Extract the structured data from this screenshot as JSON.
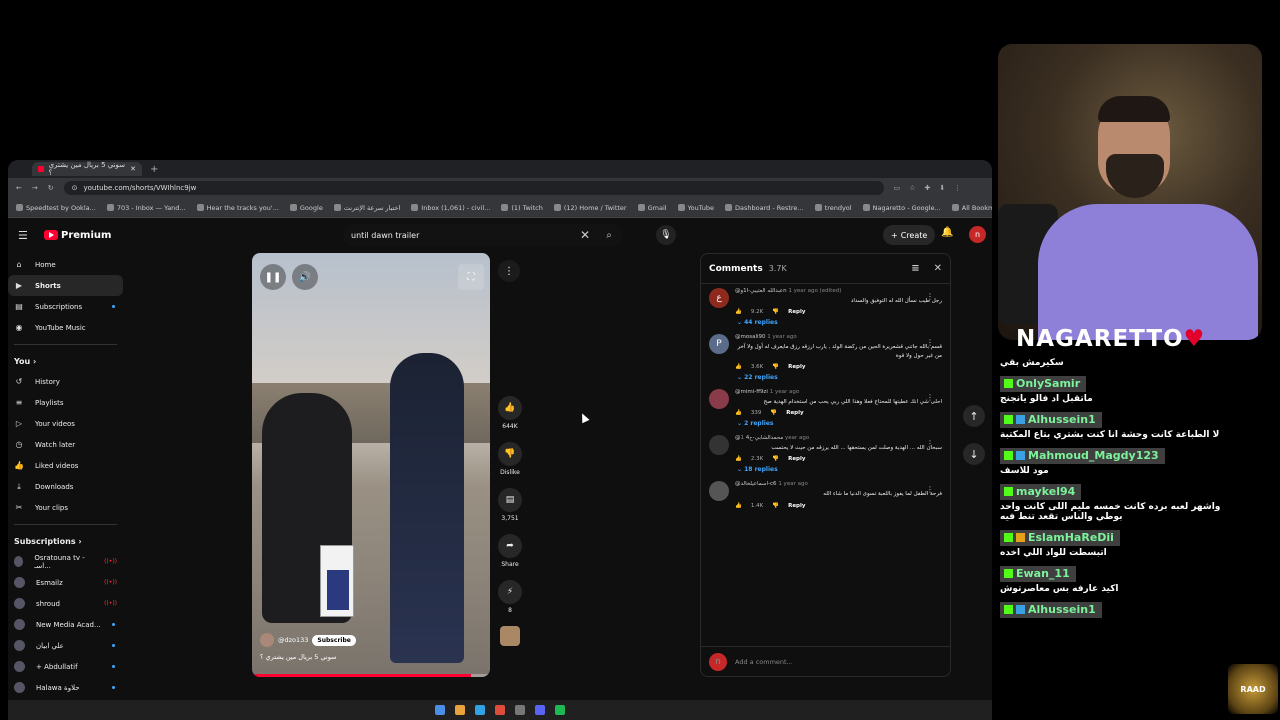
{
  "browser": {
    "tab_title": "سوني 5 بريال مين يشتري ؟",
    "url": "youtube.com/shorts/VWIhlnc9jw",
    "bookmarks": [
      "Speedtest by Ookla...",
      "703 - Inbox — Yand...",
      "Hear the tracks you'...",
      "Google",
      "اختبار سرعة الإنترنت",
      "Inbox (1,061) - civil...",
      "(1) Twitch",
      "(12) Home / Twitter",
      "Gmail",
      "YouTube",
      "Dashboard - Restre...",
      "trendyol",
      "Nagaretto - Google...",
      "All Bookmarks"
    ]
  },
  "youtube": {
    "logo_label": "Premium",
    "search_value": "until dawn trailer",
    "create_label": "Create",
    "sidebar": {
      "main": [
        {
          "label": "Home",
          "icon": "home-icon"
        },
        {
          "label": "Shorts",
          "icon": "shorts-icon"
        },
        {
          "label": "Subscriptions",
          "icon": "subscriptions-icon"
        },
        {
          "label": "YouTube Music",
          "icon": "music-icon"
        }
      ],
      "you_label": "You",
      "you": [
        {
          "label": "History"
        },
        {
          "label": "Playlists"
        },
        {
          "label": "Your videos"
        },
        {
          "label": "Watch later"
        },
        {
          "label": "Liked videos"
        },
        {
          "label": "Downloads"
        },
        {
          "label": "Your clips"
        }
      ],
      "subs_label": "Subscriptions",
      "subs": [
        {
          "label": "Osratouna tv - اسـ..."
        },
        {
          "label": "Esmailz"
        },
        {
          "label": "shroud"
        },
        {
          "label": "New Media Acad..."
        },
        {
          "label": "علي ابيان"
        },
        {
          "label": "+ Abdullatif"
        },
        {
          "label": "Halawa حلاوة"
        }
      ]
    },
    "short": {
      "channel": "@dzo133",
      "subscribe_label": "Subscribe",
      "caption": "سوني 5 بريال مين يشتري ؟",
      "progress": 0.92
    },
    "actions": {
      "likes": "644K",
      "dislike_label": "Dislike",
      "comments": "3,751",
      "share_label": "Share",
      "remix": "8"
    },
    "comments": {
      "title": "Comments",
      "count": "3.7K",
      "add_placeholder": "Add a comment...",
      "items": [
        {
          "avatar": "ع",
          "user": "@عبدالله العتيبي-ا1وn",
          "time": "1 year ago (edited)",
          "text": "رجل طيب نسأل الله له التوفيق والسداد",
          "likes": "9.2K",
          "reply_label": "Reply",
          "replies": "44 replies"
        },
        {
          "avatar": "P",
          "user": "@mosali90",
          "time": "1 year ago",
          "text": "قسم بالله جاتني قشعريرة الحين من ركضة الولد , يارب ارزقه رزق مايعرف له أول ولا آخر من غير حول ولا قوة",
          "likes": "3.6K",
          "reply_label": "Reply",
          "replies": "22 replies"
        },
        {
          "avatar": "",
          "user": "@mimi-ff9zi",
          "time": "1 year ago",
          "text": "احلى شي انك عطيتها للمحتاج فعلا وهذا اللي ربي يحب من استخدام الهدية صح",
          "likes": "339",
          "reply_label": "Reply",
          "replies": "2 replies"
        },
        {
          "avatar": "",
          "user": "@محمدالشابي-ح4",
          "time": "1 year ago",
          "text": "سبحان الله ... الهدية وصلت لمن يستحقها ... الله يرزقه من حيث لا يحتسب",
          "likes": "2.3K",
          "reply_label": "Reply",
          "replies": "18 replies"
        },
        {
          "avatar": "",
          "user": "@اسماعيلخالد-c6",
          "time": "1 year ago",
          "text": "فرحة الطفل لما يفوز باللعبة تسوى الدنيا ما شاء الله",
          "likes": "1.4K",
          "reply_label": "Reply",
          "replies": ""
        }
      ]
    }
  },
  "stream": {
    "streamer_name": "NAGARETTO",
    "chat": [
      {
        "user": "",
        "msg": "سكيرمش بقي",
        "color": "green"
      },
      {
        "user": "OnlySamir",
        "msg": "ماتقبل اد فالو يانجنج",
        "color": "green"
      },
      {
        "user": "Alhussein1",
        "msg": "لا الطباعة كانت وحشة انا كنت بشتري بتاع المكتبة",
        "color": "green"
      },
      {
        "user": "Mahmoud_Magdy123",
        "msg": "مود للاسف",
        "color": "green"
      },
      {
        "user": "maykel94",
        "msg": "واشهر لعبه برده كانت خمسه مليم اللى كانت واحد بوطي والناس تقعد تنط فيه",
        "color": "green"
      },
      {
        "user": "EslamHaReDii",
        "msg": "اتبسطت للواد اللي اخده",
        "color": "green"
      },
      {
        "user": "Ewan_11",
        "msg": "اكيد عارفه بس معاصرتوش",
        "color": "green"
      },
      {
        "user": "Alhussein1",
        "msg": "",
        "color": "green"
      }
    ],
    "logo_text": "RAAD"
  }
}
